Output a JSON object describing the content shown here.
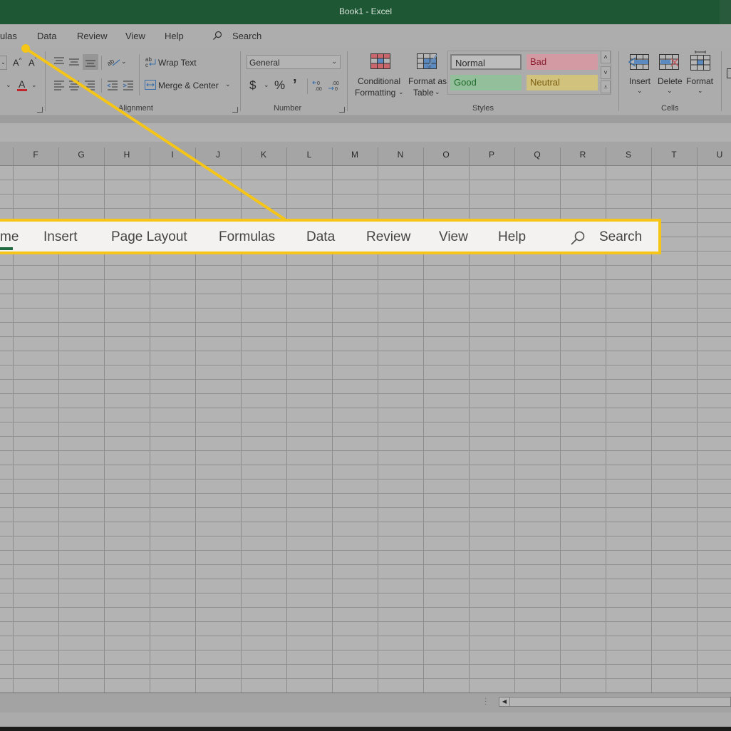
{
  "window": {
    "title": "Book1  -  Excel"
  },
  "tabs": [
    {
      "label": "ulas"
    },
    {
      "label": "Data"
    },
    {
      "label": "Review"
    },
    {
      "label": "View"
    },
    {
      "label": "Help"
    }
  ],
  "search": {
    "label": "Search",
    "icon": "search-icon"
  },
  "ribbon": {
    "alignment": {
      "wrap_text": "Wrap Text",
      "merge_center": "Merge & Center",
      "label": "Alignment"
    },
    "number": {
      "format_value": "General",
      "currency": "$",
      "percent": "%",
      "comma": "’",
      "label": "Number"
    },
    "styles": {
      "conditional_formatting": [
        "Conditional",
        "Formatting"
      ],
      "format_as_table": [
        "Format as",
        "Table"
      ],
      "gallery": [
        {
          "name": "Normal",
          "bg": "#bdbdbd",
          "fg": "#222222"
        },
        {
          "name": "Bad",
          "bg": "#d39aa3",
          "fg": "#8a1f2e"
        },
        {
          "name": "Good",
          "bg": "#93bf9a",
          "fg": "#1f6a2c"
        },
        {
          "name": "Neutral",
          "bg": "#d1c27e",
          "fg": "#7a5e10"
        }
      ],
      "label": "Styles"
    },
    "cells": {
      "insert": "Insert",
      "delete": "Delete",
      "format": "Format",
      "label": "Cells"
    }
  },
  "columns": [
    "F",
    "G",
    "H",
    "I",
    "J",
    "K",
    "L",
    "M",
    "N",
    "O",
    "P",
    "Q",
    "R",
    "S",
    "T",
    "U"
  ],
  "callout": {
    "tabs": [
      "me",
      "Insert",
      "Page Layout",
      "Formulas",
      "Data",
      "Review",
      "View",
      "Help"
    ],
    "search_label": "Search",
    "highlight_color": "#f5c518",
    "active_underline_color": "#1e6b40"
  }
}
